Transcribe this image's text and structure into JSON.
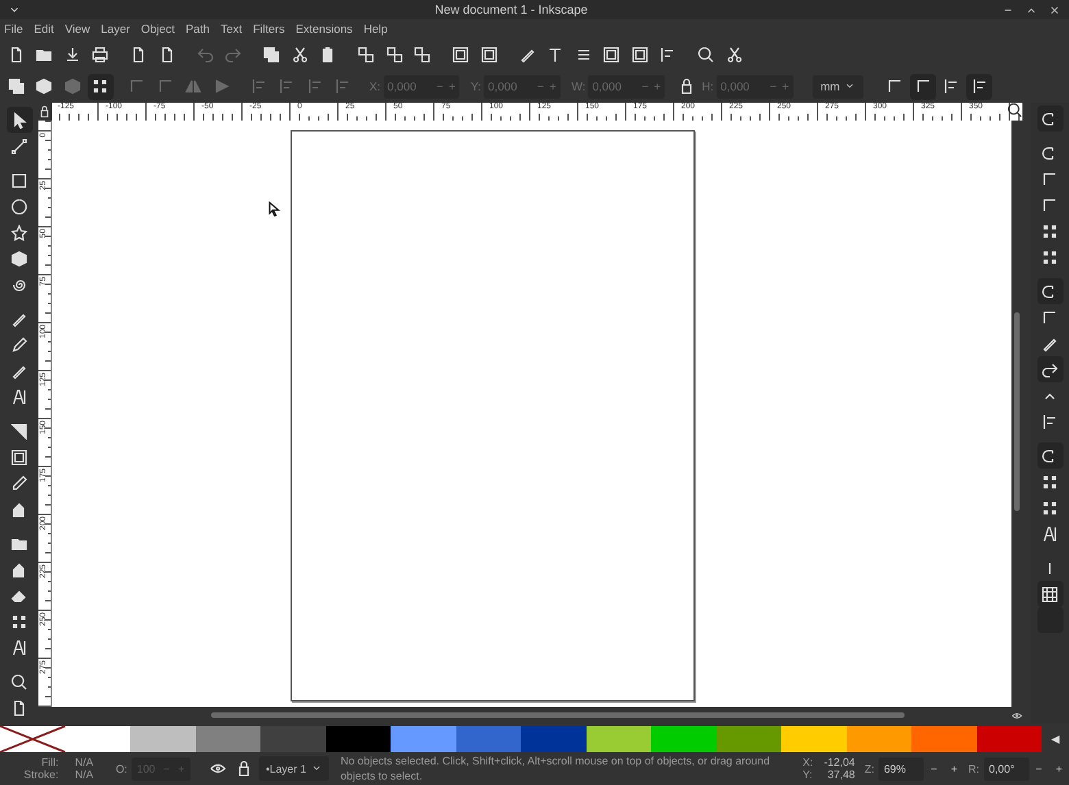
{
  "window": {
    "title": "New document 1 - Inkscape"
  },
  "menu": [
    {
      "label": "File"
    },
    {
      "label": "Edit"
    },
    {
      "label": "View"
    },
    {
      "label": "Layer"
    },
    {
      "label": "Object"
    },
    {
      "label": "Path"
    },
    {
      "label": "Text"
    },
    {
      "label": "Filters"
    },
    {
      "label": "Extensions"
    },
    {
      "label": "Help"
    }
  ],
  "tool_controls": {
    "fields": [
      {
        "label": "X:",
        "value": "0,000",
        "minus": "−",
        "plus": "+",
        "disabled": true
      },
      {
        "label": "Y:",
        "value": "0,000",
        "minus": "−",
        "plus": "+",
        "disabled": true
      },
      {
        "label": "W:",
        "value": "0,000",
        "minus": "−",
        "plus": "+",
        "disabled": true
      },
      {
        "label": "H:",
        "value": "0,000",
        "minus": "−",
        "plus": "+",
        "disabled": true
      }
    ],
    "unit": "mm"
  },
  "top_ruler": {
    "labels": [
      "-125",
      "-100",
      "-75",
      "-50",
      "-25",
      "0",
      "25",
      "50",
      "75",
      "100",
      "125",
      "150",
      "175",
      "200",
      "225",
      "250",
      "275",
      "300",
      "325",
      "350"
    ]
  },
  "left_ruler": {
    "labels": [
      "0",
      "25",
      "50",
      "75",
      "100",
      "125",
      "150",
      "175",
      "200",
      "225",
      "250",
      "275"
    ]
  },
  "palette": {
    "swatches": [
      {
        "kind": "none"
      },
      {
        "kind": "color",
        "color": "#ffffff"
      },
      {
        "kind": "color",
        "color": "#bebebe"
      },
      {
        "kind": "color",
        "color": "#808080"
      },
      {
        "kind": "color",
        "color": "#404040"
      },
      {
        "kind": "color",
        "color": "#000000"
      },
      {
        "kind": "color",
        "color": "#6699ff"
      },
      {
        "kind": "color",
        "color": "#3366cc"
      },
      {
        "kind": "color",
        "color": "#003399"
      },
      {
        "kind": "color",
        "color": "#99cc33"
      },
      {
        "kind": "color",
        "color": "#00cc00"
      },
      {
        "kind": "color",
        "color": "#669900"
      },
      {
        "kind": "color",
        "color": "#ffcc00"
      },
      {
        "kind": "color",
        "color": "#ff9900"
      },
      {
        "kind": "color",
        "color": "#ff6600"
      },
      {
        "kind": "color",
        "color": "#cc0000"
      }
    ],
    "scroll_arrow": "◀"
  },
  "status_bar": {
    "fill_label": "Fill:",
    "fill_value": "N/A",
    "stroke_label": "Stroke:",
    "stroke_value": "N/A",
    "opacity": {
      "label": "O:",
      "value": "100",
      "minus": "−",
      "plus": "+",
      "disabled": true
    },
    "layer": "•Layer 1",
    "message": "No objects selected. Click, Shift+click, Alt+scroll mouse on top of objects, or drag around objects to select.",
    "x_label": "X:",
    "x_value": "-12,04",
    "y_label": "Y:",
    "y_value": "37,48",
    "zoom": {
      "label": "Z:",
      "value": "69%",
      "minus": "−",
      "plus": "+"
    },
    "rotation": {
      "label": "R:",
      "value": "0,00°",
      "minus": "−",
      "plus": "+"
    }
  }
}
